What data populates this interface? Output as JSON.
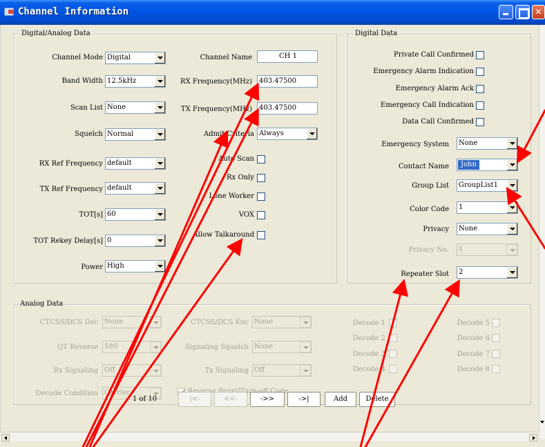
{
  "window": {
    "title": "Channel Information"
  },
  "digital_analog": {
    "title": "Digital/Analog Data",
    "channel_mode": {
      "label": "Channel Mode",
      "value": "Digital"
    },
    "band_width": {
      "label": "Band Width",
      "value": "12.5kHz"
    },
    "scan_list": {
      "label": "Scan List",
      "value": "None"
    },
    "squelch": {
      "label": "Squelch",
      "value": "Normal"
    },
    "rx_ref": {
      "label": "RX Ref Frequency",
      "value": "default"
    },
    "tx_ref": {
      "label": "TX Ref Frequency",
      "value": "default"
    },
    "tot": {
      "label": "TOT[s]",
      "value": "60"
    },
    "tot_rekey": {
      "label": "TOT Rekey Delay[s]",
      "value": "0"
    },
    "power": {
      "label": "Power",
      "value": "High"
    },
    "channel_name": {
      "label": "Channel Name",
      "value": "CH 1"
    },
    "rx_freq": {
      "label": "RX Frequency(MHz)",
      "value": "403.47500"
    },
    "tx_freq": {
      "label": "TX Frequency(MHz)",
      "value": "403.47500"
    },
    "admit": {
      "label": "Admit Criteria",
      "value": "Always"
    },
    "auto_scan": {
      "label": "Auto Scan"
    },
    "rx_only": {
      "label": "Rx Only"
    },
    "lone_worker": {
      "label": "Lone Worker"
    },
    "vox": {
      "label": "VOX"
    },
    "talkaround": {
      "label": "Allow Talkaround"
    }
  },
  "digital": {
    "title": "Digital Data",
    "private_call": {
      "label": "Private Call Confirmed"
    },
    "emerg_alarm_ind": {
      "label": "Emergency Alarm Indication"
    },
    "emerg_alarm_ack": {
      "label": "Emergency Alarm Ack"
    },
    "emerg_call_ind": {
      "label": "Emergency Call Indication"
    },
    "data_call": {
      "label": "Data Call Confirmed"
    },
    "emerg_system": {
      "label": "Emergency System",
      "value": "None"
    },
    "contact_name": {
      "label": "Contact Name",
      "value": "John"
    },
    "group_list": {
      "label": "Group List",
      "value": "GroupList1"
    },
    "color_code": {
      "label": "Color Code",
      "value": "1"
    },
    "privacy": {
      "label": "Privacy",
      "value": "None"
    },
    "privacy_no": {
      "label": "Privacy No.",
      "value": "1"
    },
    "repeater_slot": {
      "label": "Repeater Slot",
      "value": "2"
    }
  },
  "analog": {
    "title": "Analog Data",
    "ctcss_dec": {
      "label": "CTCSS/DCS Dec",
      "value": "None"
    },
    "qt_reverse": {
      "label": "QT Reverse",
      "value": "180"
    },
    "rx_signaling": {
      "label": "Rx Signaling",
      "value": "Off"
    },
    "decode_condition": {
      "label": "Decode Condition",
      "value": "Carrier"
    },
    "ctcss_enc": {
      "label": "CTCSS/DCS Enc",
      "value": "None"
    },
    "signaling_squelch": {
      "label": "Signaling Squelch",
      "value": "None"
    },
    "tx_signaling": {
      "label": "Tx Signaling",
      "value": "Off"
    },
    "reverse_burst": {
      "label": "Reverse Burst/Turn-off Code"
    },
    "decodes": [
      "Decode 1",
      "Decode 2",
      "Decode 3",
      "Decode 4",
      "Decode 5",
      "Decode 6",
      "Decode 7",
      "Decode 8"
    ]
  },
  "pager": {
    "position": "1 of 10",
    "first": "|<-",
    "prev": "<<-",
    "next": "->>",
    "last": "->|",
    "add": "Add",
    "delete": "Delete"
  },
  "colors": {
    "titlebar": "#0054e3",
    "annotation": "#ff0000",
    "selection": "#316ac5"
  }
}
